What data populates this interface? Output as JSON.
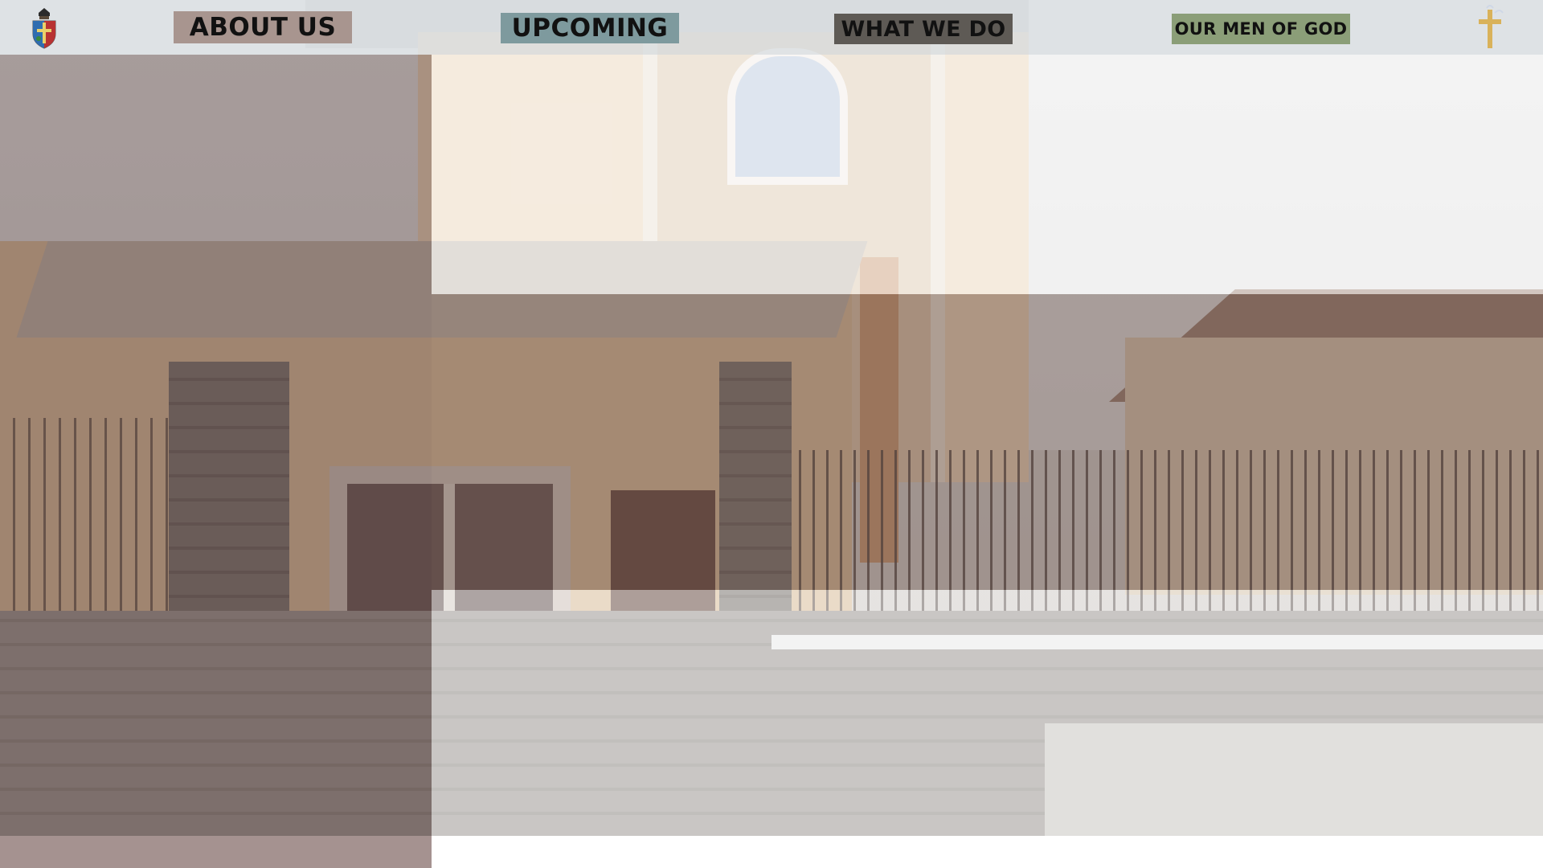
{
  "header": {
    "nav": [
      {
        "label": "ABOUT US"
      },
      {
        "label": "UPCOMING"
      },
      {
        "label": "WHAT WE DO"
      },
      {
        "label": "OUR MEN OF GOD"
      }
    ],
    "logo_icon": "church-crest-icon",
    "right_icon": "cross-icon"
  },
  "colors": {
    "nav_about_bg": "#a8958f",
    "nav_upcoming_bg": "#7e9a9e",
    "nav_whatwedo_bg": "#5e5a55",
    "nav_men_bg": "#8b9e78",
    "overlay_dark": "#5c423c",
    "footer_left": "#a59290"
  },
  "hero": {
    "image": "church-building-photo"
  }
}
